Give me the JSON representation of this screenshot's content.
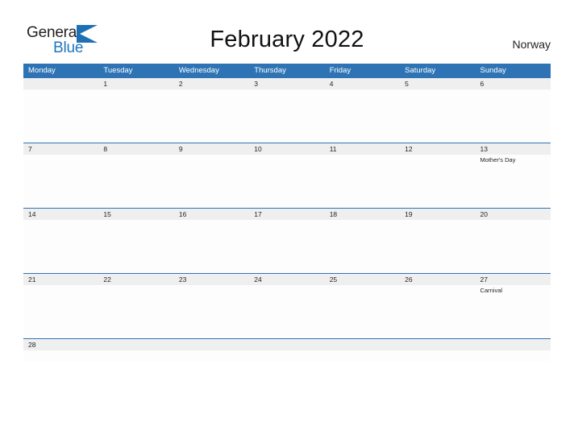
{
  "brand": {
    "name_part1": "General",
    "name_part2": "Blue",
    "logo_icon": "general-blue-triangle-logo"
  },
  "header": {
    "title": "February 2022",
    "country": "Norway"
  },
  "calendar": {
    "month": "February",
    "year": "2022",
    "weekday_headers": [
      "Monday",
      "Tuesday",
      "Wednesday",
      "Thursday",
      "Friday",
      "Saturday",
      "Sunday"
    ],
    "colors": {
      "header_blue": "#2e74b5",
      "row_divider_blue": "#2e74b5",
      "number_band_gray": "#efefef",
      "logo_blue": "#1f76bd",
      "text_dark": "#231f20"
    },
    "weeks": [
      [
        {
          "date": "",
          "events": []
        },
        {
          "date": "1",
          "events": []
        },
        {
          "date": "2",
          "events": []
        },
        {
          "date": "3",
          "events": []
        },
        {
          "date": "4",
          "events": []
        },
        {
          "date": "5",
          "events": []
        },
        {
          "date": "6",
          "events": []
        }
      ],
      [
        {
          "date": "7",
          "events": []
        },
        {
          "date": "8",
          "events": []
        },
        {
          "date": "9",
          "events": []
        },
        {
          "date": "10",
          "events": []
        },
        {
          "date": "11",
          "events": []
        },
        {
          "date": "12",
          "events": []
        },
        {
          "date": "13",
          "events": [
            "Mother's Day"
          ]
        }
      ],
      [
        {
          "date": "14",
          "events": []
        },
        {
          "date": "15",
          "events": []
        },
        {
          "date": "16",
          "events": []
        },
        {
          "date": "17",
          "events": []
        },
        {
          "date": "18",
          "events": []
        },
        {
          "date": "19",
          "events": []
        },
        {
          "date": "20",
          "events": []
        }
      ],
      [
        {
          "date": "21",
          "events": []
        },
        {
          "date": "22",
          "events": []
        },
        {
          "date": "23",
          "events": []
        },
        {
          "date": "24",
          "events": []
        },
        {
          "date": "25",
          "events": []
        },
        {
          "date": "26",
          "events": []
        },
        {
          "date": "27",
          "events": [
            "Carnival"
          ]
        }
      ],
      [
        {
          "date": "28",
          "events": []
        },
        {
          "date": "",
          "events": []
        },
        {
          "date": "",
          "events": []
        },
        {
          "date": "",
          "events": []
        },
        {
          "date": "",
          "events": []
        },
        {
          "date": "",
          "events": []
        },
        {
          "date": "",
          "events": []
        }
      ]
    ]
  }
}
